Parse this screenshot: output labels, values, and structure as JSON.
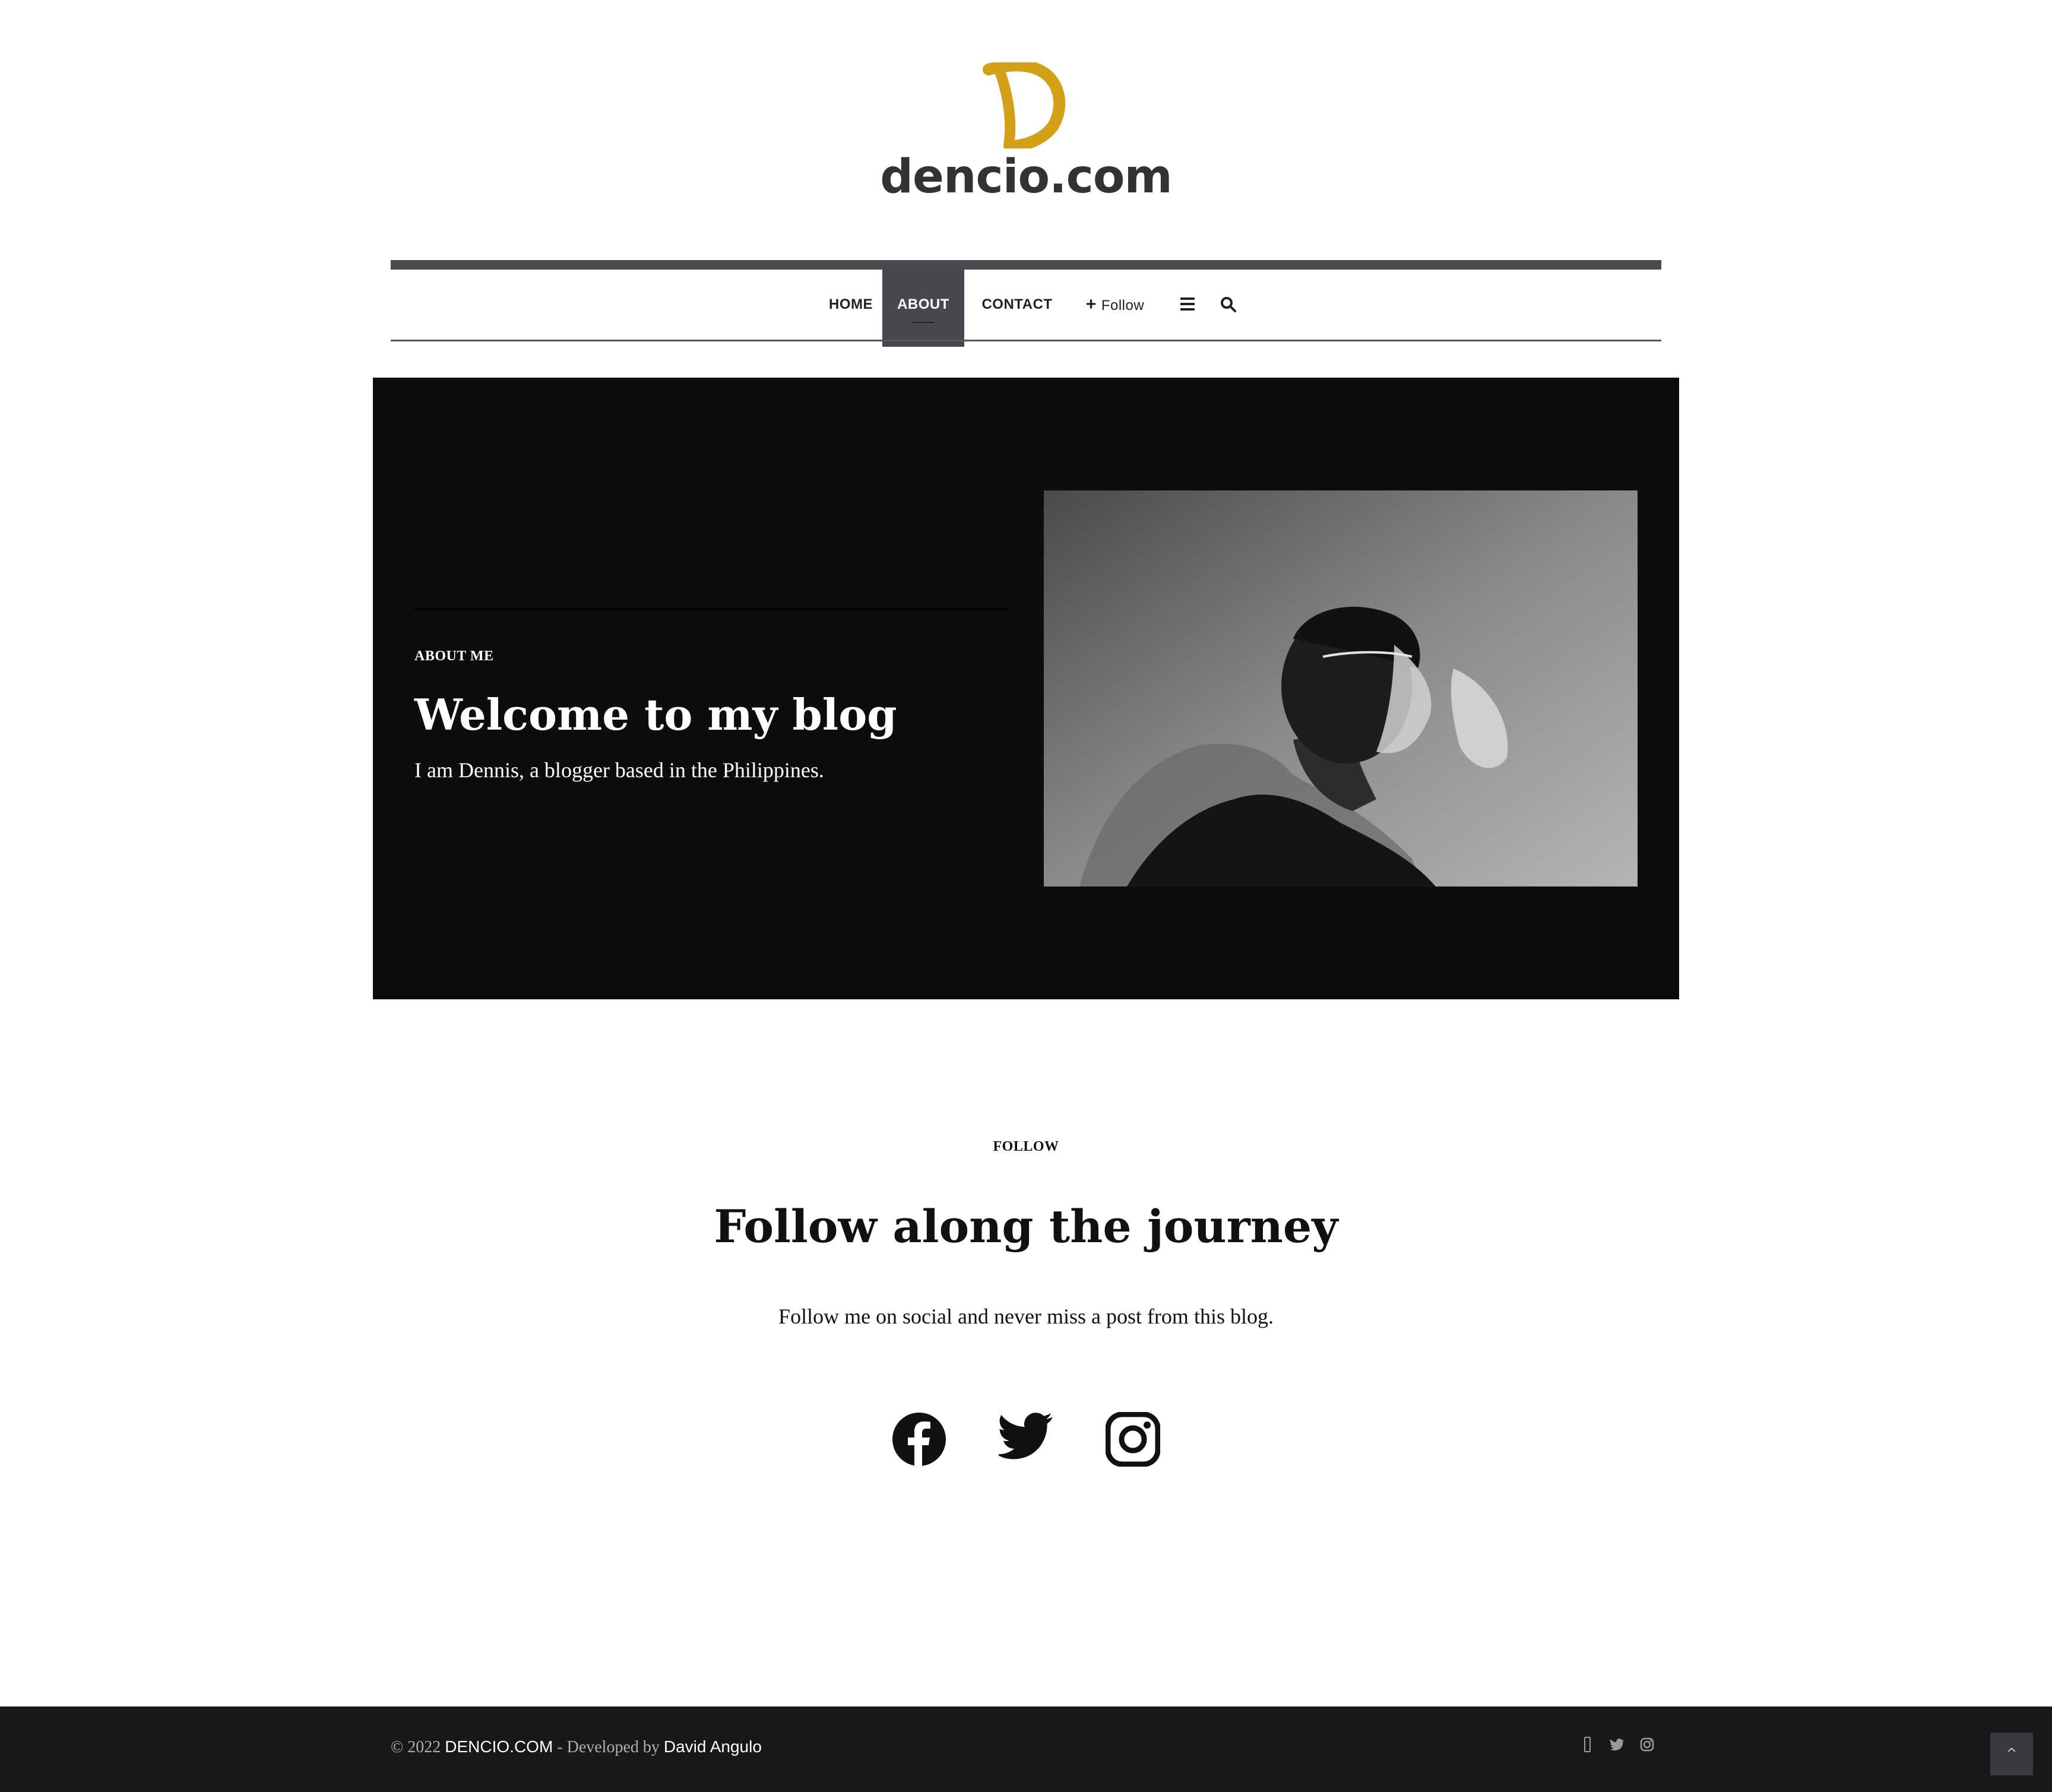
{
  "site": {
    "logo_text": "dencio.com",
    "brand_color": "#d4a017"
  },
  "nav": {
    "items": [
      {
        "label": "HOME"
      },
      {
        "label": "ABOUT",
        "active": true
      },
      {
        "label": "CONTACT"
      }
    ],
    "follow_label": "Follow",
    "follow_icon": "plus-icon",
    "menu_icon": "hamburger-menu-icon",
    "search_icon": "search-icon",
    "active_bg": "#48484e"
  },
  "hero": {
    "eyebrow": "ABOUT ME",
    "title": "Welcome to my blog",
    "text": "I am Dennis, a blogger based in the Philippines.",
    "background": "#0d0d0e"
  },
  "follow_section": {
    "eyebrow": "FOLLOW",
    "title": "Follow along the journey",
    "text": "Follow me on social and never miss a post from this blog.",
    "icons": [
      "facebook-icon",
      "twitter-icon",
      "instagram-icon"
    ]
  },
  "footer": {
    "copyright_prefix": "© 2022",
    "site_name": "DENCIO.COM",
    "developed_by_text": "- Developed by",
    "developer_name": "David Angulo",
    "icons": [
      "facebook-icon",
      "twitter-icon",
      "instagram-icon"
    ],
    "back_to_top_icon": "chevron-up-icon",
    "background": "#18181a"
  }
}
